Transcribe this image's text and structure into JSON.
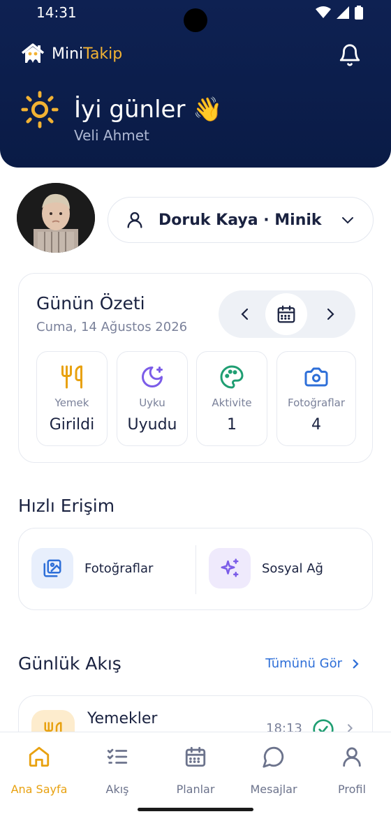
{
  "status_bar": {
    "time": "14:31"
  },
  "header": {
    "brand_first": "Mini",
    "brand_second": "Takip",
    "greeting": "İyi günler 👋",
    "user_name": "Veli Ahmet"
  },
  "child_selector": {
    "label": "Doruk Kaya · Minik ..."
  },
  "summary": {
    "title": "Günün Özeti",
    "date": "Cuma, 14 Ağustos 2026",
    "stats": [
      {
        "icon": "utensils-icon",
        "label": "Yemek",
        "value": "Girildi",
        "color": "#e8a10f"
      },
      {
        "icon": "moon-stars-icon",
        "label": "Uyku",
        "value": "Uyudu",
        "color": "#7b5ce8"
      },
      {
        "icon": "palette-icon",
        "label": "Aktivite",
        "value": "1",
        "color": "#1f9e72"
      },
      {
        "icon": "camera-icon",
        "label": "Fotoğraflar",
        "value": "4",
        "color": "#2e6fd8"
      }
    ]
  },
  "quick_access": {
    "title": "Hızlı Erişim",
    "items": [
      {
        "icon": "photo-gallery-icon",
        "label": "Fotoğraflar",
        "bg": "#e8effc",
        "color": "#2e6fd8"
      },
      {
        "icon": "sparkles-icon",
        "label": "Sosyal Ağ",
        "bg": "#efeafc",
        "color": "#7b5ce8"
      }
    ]
  },
  "daily_feed": {
    "title": "Günlük Akış",
    "see_all": "Tümünü Gör",
    "items": [
      {
        "icon": "utensils-icon",
        "title": "Yemekler",
        "time": "18:13"
      }
    ]
  },
  "bottom_nav": {
    "items": [
      {
        "icon": "home-icon",
        "label": "Ana Sayfa",
        "active": true
      },
      {
        "icon": "list-check-icon",
        "label": "Akış"
      },
      {
        "icon": "calendar-icon",
        "label": "Planlar"
      },
      {
        "icon": "message-icon",
        "label": "Mesajlar"
      },
      {
        "icon": "user-icon",
        "label": "Profil"
      }
    ]
  },
  "colors": {
    "header_bg": "#0e2152",
    "accent_yellow": "#f2b233",
    "active_nav": "#e8a10f",
    "link_blue": "#2e6fd8"
  }
}
